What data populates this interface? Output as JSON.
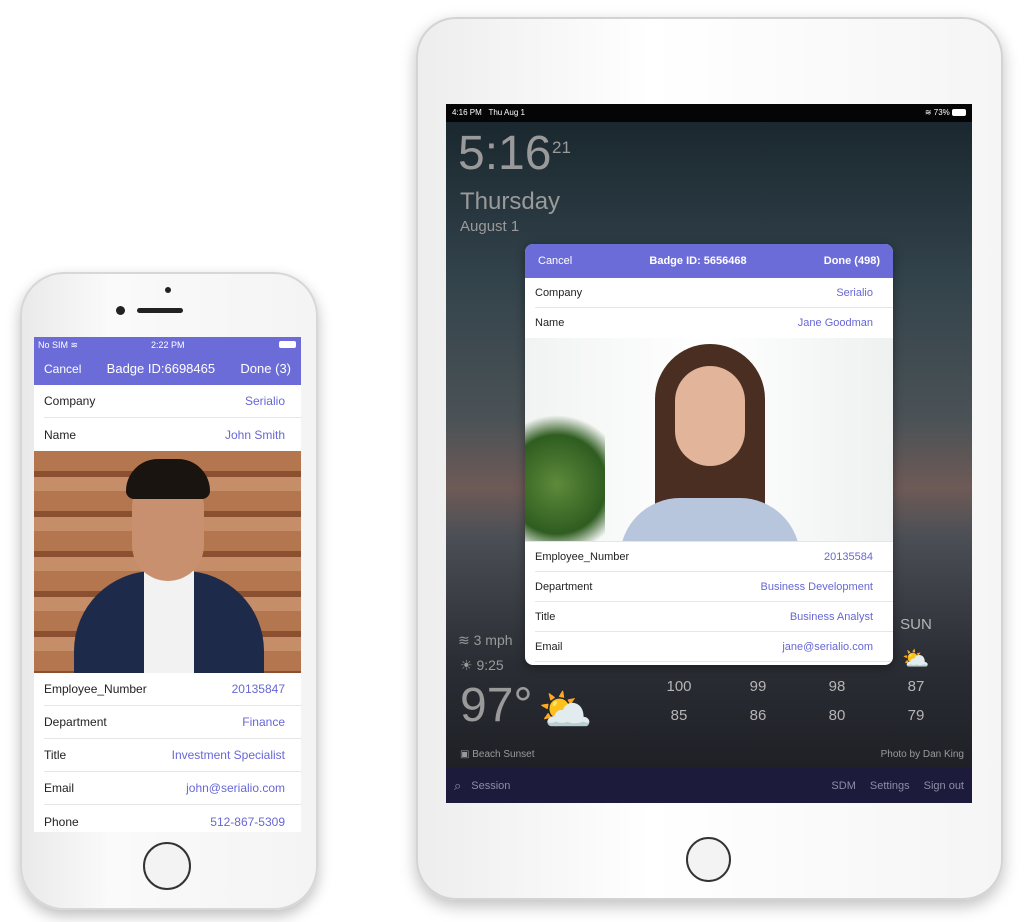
{
  "phone": {
    "status": {
      "carrier": "No SIM",
      "time": "2:22 PM"
    },
    "nav": {
      "cancel": "Cancel",
      "title": "Badge ID:6698465",
      "done": "Done (3)"
    },
    "rows_top": [
      {
        "label": "Company",
        "value": "Serialio"
      },
      {
        "label": "Name",
        "value": "John Smith"
      }
    ],
    "rows_bottom": [
      {
        "label": "Employee_Number",
        "value": "20135847"
      },
      {
        "label": "Department",
        "value": "Finance"
      },
      {
        "label": "Title",
        "value": "Investment Specialist"
      },
      {
        "label": "Email",
        "value": "john@serialio.com"
      },
      {
        "label": "Phone",
        "value": "512-867-5309"
      }
    ]
  },
  "tablet": {
    "status": {
      "time": "4:16 PM",
      "date": "Thu Aug 1",
      "battery": "73%"
    },
    "clock": {
      "time": "5:16",
      "seconds": "21",
      "day": "Thursday",
      "date": "August 1"
    },
    "modal": {
      "cancel": "Cancel",
      "title": "Badge ID: 5656468",
      "done": "Done (498)",
      "rows_top": [
        {
          "label": "Company",
          "value": "Serialio"
        },
        {
          "label": "Name",
          "value": "Jane Goodman"
        }
      ],
      "rows_bottom": [
        {
          "label": "Employee_Number",
          "value": "20135584"
        },
        {
          "label": "Department",
          "value": "Business Development"
        },
        {
          "label": "Title",
          "value": "Business Analyst"
        },
        {
          "label": "Email",
          "value": "jane@serialio.com"
        }
      ]
    },
    "weather": {
      "wind": "3 mph",
      "sunset": "9:25",
      "temp": "97°",
      "forecast": [
        {
          "day": "",
          "high": "100",
          "low": "85"
        },
        {
          "day": "",
          "high": "99",
          "low": "86"
        },
        {
          "day": "",
          "high": "98",
          "low": "80"
        },
        {
          "day": "SUN",
          "high": "87",
          "low": "79"
        }
      ],
      "photo_title": "Beach Sunset",
      "photo_credit": "Photo by Dan King"
    },
    "bar": {
      "search": "Session",
      "sdm": "SDM",
      "settings": "Settings",
      "signout": "Sign out"
    }
  },
  "colors": {
    "accent": "#6c6cd8",
    "value_text": "#6767d6",
    "bottom_bar": "#1d1b3b"
  }
}
